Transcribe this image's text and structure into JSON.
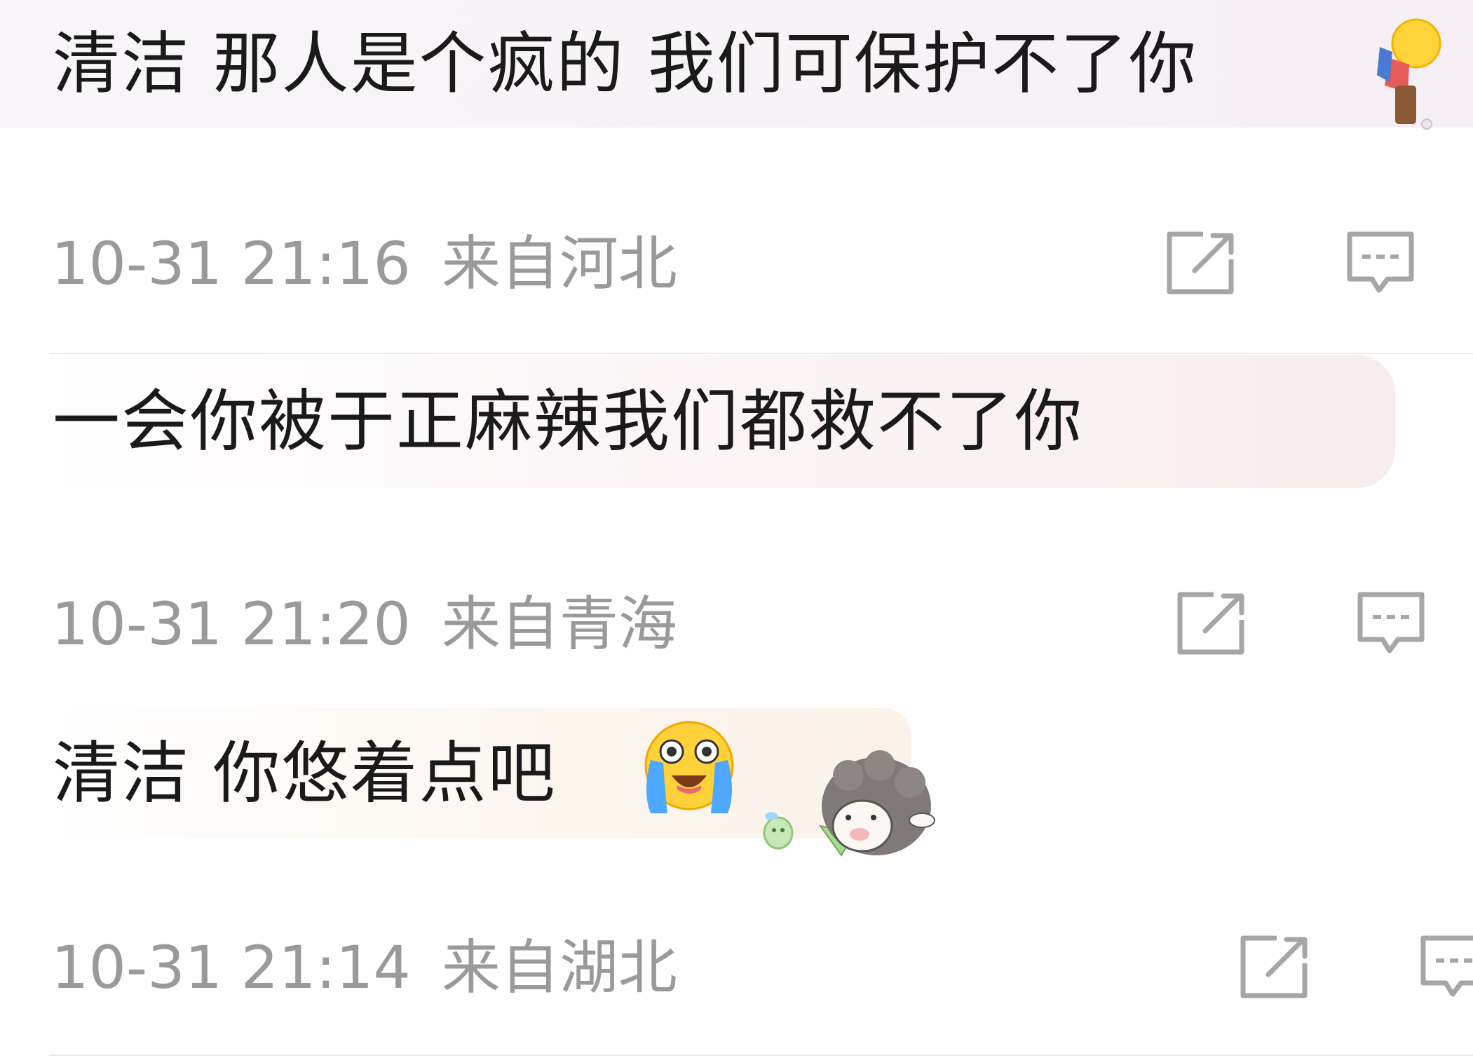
{
  "comments": [
    {
      "text": "清洁 那人是个疯的 我们可保护不了你",
      "time": "10-31 21:16",
      "location": "来自河北",
      "emoji": "person-bowing-emoji"
    },
    {
      "text": "一会你被于正麻辣我们都救不了你",
      "time": "10-31 21:20",
      "location": "来自青海"
    },
    {
      "text": "清洁 你悠着点吧",
      "time": "10-31 21:14",
      "location": "来自湖北",
      "emoji": "loud-crying-emoji",
      "sticker": "sheep-eating-grass-sticker"
    }
  ],
  "colors": {
    "text": "#1a1a1a",
    "meta": "#9a9a9a",
    "icon": "#a6a6a6",
    "divider": "#ebebeb"
  },
  "icons": [
    "share-icon",
    "comment-icon"
  ]
}
